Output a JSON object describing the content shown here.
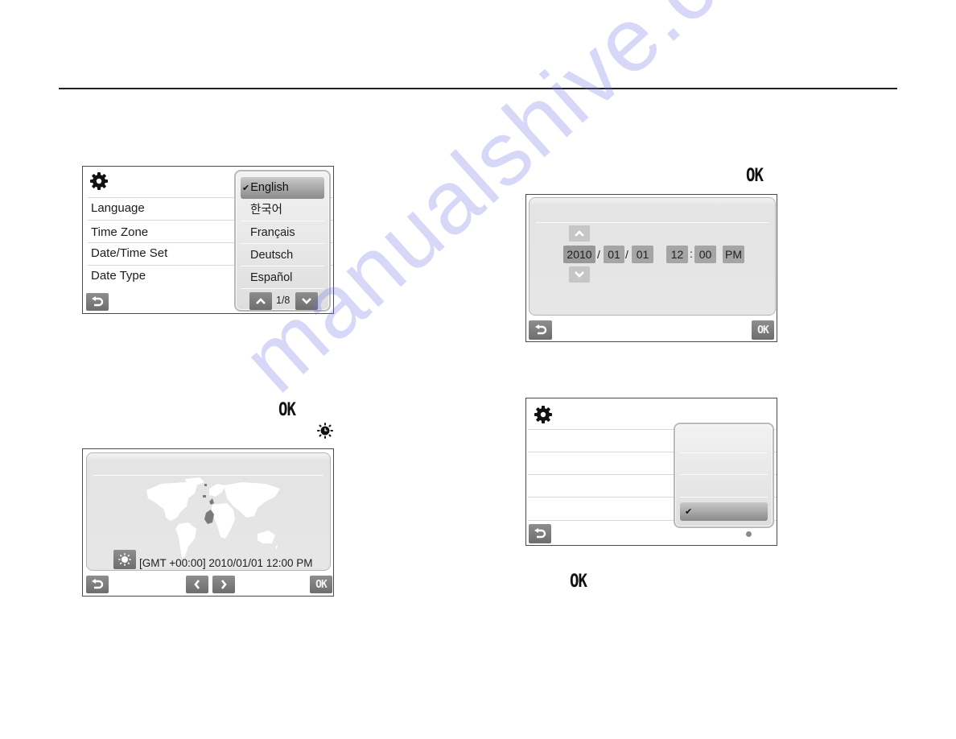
{
  "page": {
    "watermark": "manualshive.com"
  },
  "instructions": {
    "ok_icon_label_1": "OK",
    "ok_icon_label_2": "OK",
    "ok_icon_label_3": "OK",
    "dst_icon": "daylight-saving-icon"
  },
  "language_screen": {
    "menu_items": [
      "Language",
      "Time Zone",
      "Date/Time Set",
      "Date Type"
    ],
    "popup": {
      "options": [
        "English",
        "한국어",
        "Français",
        "Deutsch",
        "Español"
      ],
      "selected_index": 0,
      "page_indicator": "1/8"
    },
    "icons": {
      "header": "gear-icon",
      "back": "back-icon",
      "up": "chevron-up-icon",
      "down": "chevron-down-icon"
    }
  },
  "timezone_screen": {
    "timezone_text": "[GMT +00:00] 2010/01/01 12:00 PM",
    "ok_label": "OK",
    "icons": {
      "dst": "daylight-saving-icon",
      "back": "back-icon",
      "prev": "chevron-left-icon",
      "next": "chevron-right-icon",
      "map": "world-map"
    }
  },
  "datetime_screen": {
    "year": "2010",
    "month": "01",
    "day": "01",
    "hour": "12",
    "minute": "00",
    "ampm": "PM",
    "date_sep": "/",
    "time_sep": ":",
    "ok_label": "OK",
    "active_field": "year"
  },
  "datetype_screen": {
    "menu_rows": 4,
    "popup_options": 4,
    "selected_index": 3
  }
}
